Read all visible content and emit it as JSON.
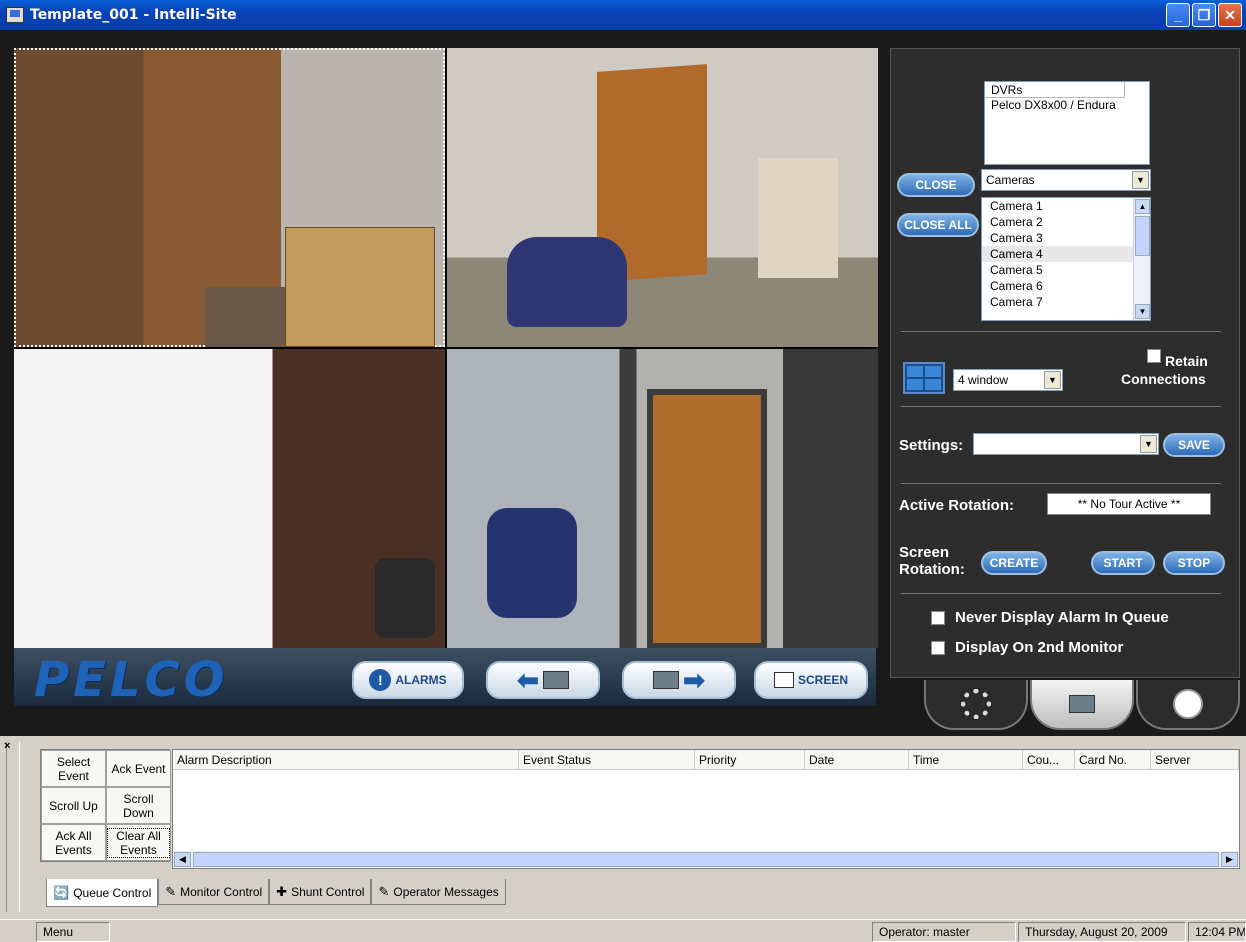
{
  "window": {
    "title": "Template_001 - Intelli-Site",
    "buttons": [
      "_",
      "❐",
      "✕"
    ]
  },
  "toolbar": {
    "logo": "PELCO",
    "alarms_label": "ALARMS",
    "screen_label": "SCREEN"
  },
  "panel": {
    "dvr_header": "DVRs",
    "dvr_items": [
      "Pelco DX8x00 / Endura"
    ],
    "close_label": "CLOSE",
    "close_all_label": "CLOSE ALL",
    "camera_select": "Cameras",
    "cameras": [
      "Camera 1",
      "Camera 2",
      "Camera 3",
      "Camera 4",
      "Camera 5",
      "Camera 6",
      "Camera 7"
    ],
    "selected_camera": "Camera 4",
    "window_layout": "4 window",
    "retain_label": "Retain",
    "connections_label": "Connections",
    "settings_label": "Settings:",
    "settings_value": "",
    "save_label": "SAVE",
    "active_rotation_label": "Active Rotation:",
    "active_rotation_value": "** No Tour Active **",
    "screen_label": "Screen",
    "rotation_label": "Rotation:",
    "create_label": "CREATE",
    "start_label": "START",
    "stop_label": "STOP",
    "never_display_label": "Never Display Alarm In Queue",
    "second_monitor_label": "Display On 2nd Monitor"
  },
  "queue": {
    "buttons": [
      {
        "label": "Select Event"
      },
      {
        "label": "Ack Event"
      },
      {
        "label": "Scroll Up"
      },
      {
        "label": "Scroll Down"
      },
      {
        "label": "Ack All Events"
      },
      {
        "label": "Clear All Events"
      }
    ],
    "columns": [
      "Alarm Description",
      "Event Status",
      "Priority",
      "Date",
      "Time",
      "Cou...",
      "Card No.",
      "Server"
    ]
  },
  "tabs": [
    "Queue Control",
    "Monitor Control",
    "Shunt Control",
    "Operator Messages"
  ],
  "status": {
    "menu": "Menu",
    "operator": "Operator: master",
    "date": "Thursday, August 20, 2009",
    "time": "12:04 PM"
  },
  "colors": {
    "titlebar": "#0842b5",
    "panel_bg": "#2d2d2d",
    "pill": "#2e6ab8",
    "logo": "#1f63b8"
  }
}
